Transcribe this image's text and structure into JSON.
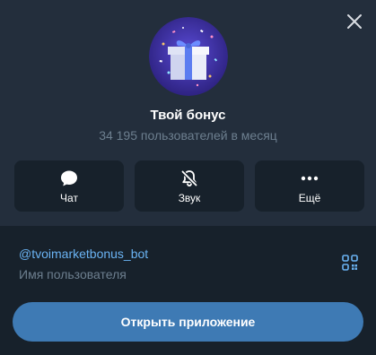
{
  "profile": {
    "name": "Твой бонус",
    "subtitle": "34 195 пользователей в месяц"
  },
  "actions": [
    {
      "label": "Чат",
      "icon": "chat-bubble-icon"
    },
    {
      "label": "Звук",
      "icon": "bell-muted-icon"
    },
    {
      "label": "Ещё",
      "icon": "more-dots-icon"
    }
  ],
  "info": {
    "username": "@tvoimarketbonus_bot",
    "username_caption": "Имя пользователя",
    "qr_icon": "qr-code-icon"
  },
  "open_button": {
    "label": "Открыть приложение"
  },
  "colors": {
    "background": "#17212b",
    "header": "#232e3c",
    "accent": "#3e7ab4",
    "link": "#6ab3f3",
    "muted": "#6d7f8f"
  }
}
